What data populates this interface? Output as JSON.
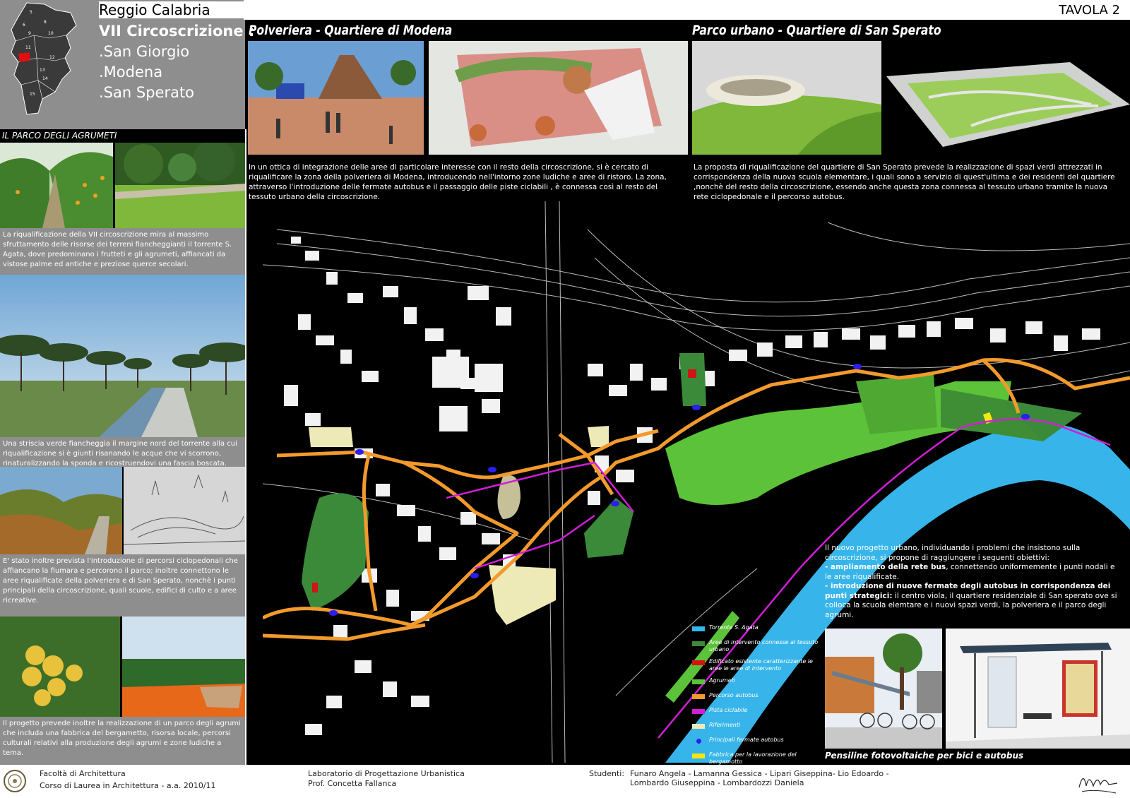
{
  "header": {
    "city": "Reggio Calabria",
    "tavola": "TAVOLA 2",
    "circoscrizione": "VII Circoscrizione :",
    "quartieri": [
      ".San Giorgio",
      ".Modena",
      ".San Sperato"
    ],
    "region_numbers": [
      "5",
      "6",
      "8",
      "9",
      "10",
      "11",
      "12",
      "13",
      "14",
      "15"
    ]
  },
  "sidebar": {
    "heading": "IL PARCO DEGLI AGRUMETI",
    "text1": "La riqualificazione della VII circoscrizione mira al massimo sfruttamento delle risorse dei terreni fiancheggianti il torrente S. Agata, dove predominano i frutteti e gli agrumeti, affiancati da vistose palme ed antiche e preziose querce secolari.",
    "text2": "Una striscia verde fiancheggia il margine nord del torrente alla cui riqualificazione si è giunti risanando le acque che vi scorrono, rinaturalizzando la sponda e ricostruendovi una fascia boscata.",
    "text3": "E' stato inoltre prevista l'introduzione di percorsi ciclopedonali che affiancano la fiumara e percorono il parco; inoltre connettono le aree riqualificate della polveriera e di San Sperato, nonchè i punti principali della circoscrizione, quali scuole, edifici di culto e a aree ricreative.",
    "text4": "Il progetto prevede inoltre la realizzazione di un parco degli agrumi che includa una fabbrica del bergametto, risorsa locale, percorsi culturali relativi alla produzione degli agrumi e zone ludiche a tema."
  },
  "polveriera": {
    "title": "Polveriera - Quartiere di Modena",
    "text": "In un ottica di integrazione delle aree di particolare interesse con il resto della circoscrizione, si è cercato di riqualificare la zona della polveriera di Modena, introducendo nell'intorno zone ludiche e aree di ristoro. La zona, attraverso l'introduzione delle fermate autobus e il passaggio delle piste ciclabili , è connessa così al resto del tessuto urbano della circoscrizione."
  },
  "parco": {
    "title": "Parco urbano - Quartiere di San Sperato",
    "text": "La proposta di riqualificazione del quartiere di San Sperato prevede la realizzazione di spazi verdi attrezzati in corrispondenza della nuova scuola elementare, i quali sono a servizio di quest'ultima e dei residenti del quartiere ,nonchè del resto della circoscrizione, essendo anche questa zona connessa al tessuto urbano tramite la nuova rete ciclopedonale e il percorso autobus."
  },
  "legend": [
    {
      "label": "Torrente S. Agata",
      "color": "#35b6ee"
    },
    {
      "label": "Aree di intervento connesse al tessuto urbano",
      "color": "#3a8a3a"
    },
    {
      "label": "Edificato esistente caratterizzante le aree le aree di intervento",
      "color": "#d11414"
    },
    {
      "label": "Agrumeti",
      "color": "#5cc23a"
    },
    {
      "label": "Percorso autobus",
      "color": "#f39a2c"
    },
    {
      "label": "Pista ciclabile",
      "color": "#d21ed6"
    },
    {
      "label": "Riferimenti",
      "color": "#eeeab8"
    },
    {
      "label": "Principali fermate autobus",
      "color": "#2a1ef0"
    },
    {
      "label": "Fabbrica per la lavorazione del bergamotto",
      "color": "#f5e80e"
    }
  ],
  "objectives": {
    "intro": "Il nuovo progetto urbano, individuando i problemi che insistono sulla circoscrizione, si propone di raggiungere i seguenti obiettivi:",
    "item1_bold": "- ampliamento della rete bus",
    "item1_rest": ", connettendo uniformemente i punti nodali e le aree riqualificate.",
    "item2_bold": "- introduzione di nuove fermate degli autobus in corrispondenza dei punti strategici:",
    "item2_rest": " il centro viola, il quartiere residenziale di San sperato ove si colloca la scuola elemtare e i nuovi spazi verdi, la polveriera e il parco degli agrumi."
  },
  "caption": "Pensiline fotovoltaiche per bici e autobus",
  "footer": {
    "faculty": "Facoltà di Architettura",
    "course": "Corso di Laurea in Architettura - a.a. 2010/11",
    "lab": "Laboratorio di Progettazione Urbanistica",
    "prof": "Prof. Concetta Fallanca",
    "students_label": "Studenti:",
    "students1": "Funaro Angela - Lamanna Gessica - Lipari Giseppina- Lio Edoardo -",
    "students2": "Lombardo Giuseppina - Lombardozzi Daniela"
  }
}
